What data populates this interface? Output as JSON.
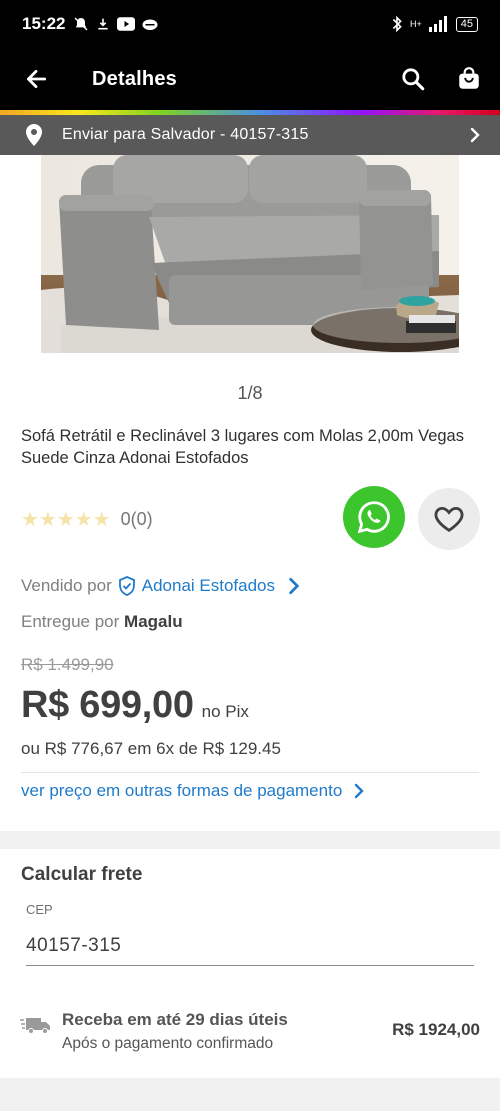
{
  "status_bar": {
    "time": "15:22",
    "battery": "45",
    "network": "H+"
  },
  "app_bar": {
    "title": "Detalhes"
  },
  "delivery": {
    "label": "Enviar para Salvador - 40157-315"
  },
  "gallery": {
    "counter": "1/8"
  },
  "product": {
    "title": "Sofá Retrátil e Reclinável 3 lugares com Molas 2,00m Vegas Suede Cinza Adonai Estofados",
    "rating_text": "0(0)",
    "stars": "★★★★★"
  },
  "seller": {
    "sold_by_label": "Vendido por",
    "seller_name": "Adonai Estofados",
    "delivered_by_label": "Entregue por",
    "delivered_by_name": "Magalu"
  },
  "pricing": {
    "old_price": "R$ 1.499,90",
    "price": "R$ 699,00",
    "price_suffix": "no Pix",
    "installments": "ou R$ 776,67 em 6x de R$ 129.45",
    "payment_link": "ver preço em outras formas de pagamento"
  },
  "freight": {
    "title": "Calcular frete",
    "cep_label": "CEP",
    "cep_value": "40157-315",
    "shipping_main": "Receba em até 29 dias úteis",
    "shipping_sub": "Após o pagamento confirmado",
    "shipping_price": "R$ 1924,00"
  },
  "colors": {
    "app_bar": "#000000",
    "delivery_bar": "#595959",
    "link_blue": "#1f7bc9",
    "whatsapp_green": "#3cc52c"
  }
}
